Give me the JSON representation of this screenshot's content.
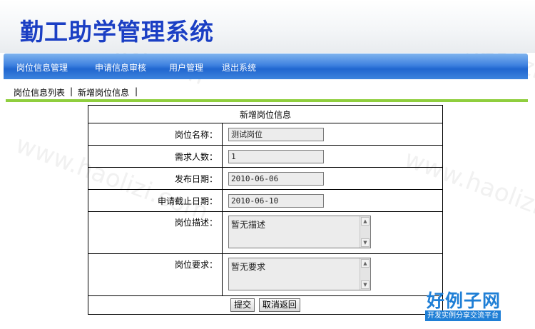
{
  "app": {
    "title": "勤工助学管理系统"
  },
  "nav": {
    "items": [
      {
        "label": "岗位信息管理"
      },
      {
        "label": "申请信息审核"
      },
      {
        "label": "用户管理"
      },
      {
        "label": "退出系统"
      }
    ]
  },
  "subnav": {
    "items": [
      {
        "label": "岗位信息列表"
      },
      {
        "label": "新增岗位信息"
      }
    ],
    "separator": "|"
  },
  "form": {
    "title": "新增岗位信息",
    "fields": {
      "name": {
        "label": "岗位名称：",
        "value": "测试岗位"
      },
      "count": {
        "label": "需求人数：",
        "value": "1"
      },
      "publish": {
        "label": "发布日期：",
        "value": "2010-06-06"
      },
      "deadline": {
        "label": "申请截止日期：",
        "value": "2010-06-10"
      },
      "desc": {
        "label": "岗位描述：",
        "value": "暂无描述"
      },
      "req": {
        "label": "岗位要求：",
        "value": "暂无要求"
      }
    },
    "submit_label": "提交",
    "cancel_label": "取消返回"
  },
  "watermark": {
    "text": "www.haolizi.com"
  },
  "logo": {
    "main": "好例子网",
    "sub": "开发实例分享交流平台"
  },
  "colors": {
    "title": "#1b3fc4",
    "nav": "#2066cf",
    "divider": "#8fce3e"
  }
}
